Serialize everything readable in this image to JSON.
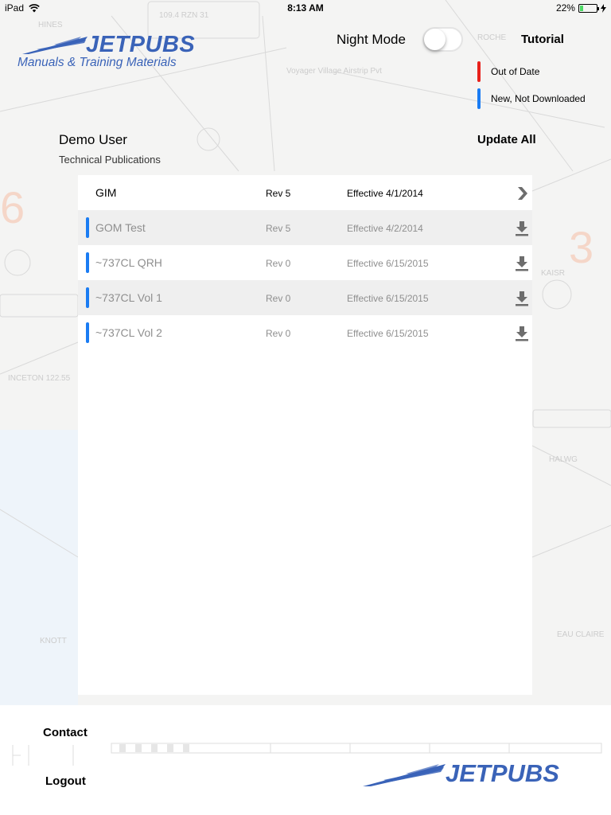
{
  "status_bar": {
    "device": "iPad",
    "time": "8:13 AM",
    "battery": "22%",
    "battery_level": 0.22
  },
  "brand": {
    "name": "JETPUBS",
    "tagline": "Manuals & Training Materials",
    "color": "#3a63b8"
  },
  "header": {
    "night_mode_label": "Night Mode",
    "night_mode_on": false,
    "tutorial_label": "Tutorial"
  },
  "legend": [
    {
      "label": "Out of Date",
      "color": "#e8211b"
    },
    {
      "label": "New, Not Downloaded",
      "color": "#1a7cf3"
    }
  ],
  "user": {
    "name": "Demo User",
    "organization": "Technical Publications"
  },
  "update_all_label": "Update All",
  "publications": [
    {
      "title": "GIM",
      "revision": "Rev 5",
      "effective": "Effective 4/1/2014",
      "status": "current",
      "action": "open"
    },
    {
      "title": "GOM Test",
      "revision": "Rev 5",
      "effective": "Effective 4/2/2014",
      "status": "new",
      "action": "download"
    },
    {
      "title": "~737CL QRH",
      "revision": "Rev 0",
      "effective": "Effective 6/15/2015",
      "status": "new",
      "action": "download"
    },
    {
      "title": "~737CL Vol 1",
      "revision": "Rev 0",
      "effective": "Effective 6/15/2015",
      "status": "new",
      "action": "download"
    },
    {
      "title": "~737CL Vol 2",
      "revision": "Rev 0",
      "effective": "Effective 6/15/2015",
      "status": "new",
      "action": "download"
    }
  ],
  "footer": {
    "contact_label": "Contact",
    "logout_label": "Logout"
  },
  "icons": {
    "wifi": "wifi-icon",
    "battery": "battery-icon",
    "charging": "charging-icon",
    "open": "chevron-right-icon",
    "download": "download-icon",
    "logo": "jet-logo-icon"
  }
}
